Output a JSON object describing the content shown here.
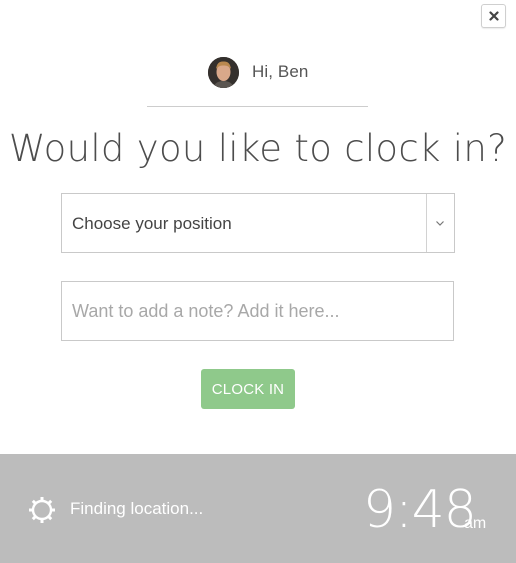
{
  "greeting": {
    "text": "Hi, Ben",
    "avatar": "user-avatar"
  },
  "headline": "Would you like to clock in?",
  "position_select": {
    "selected": "Choose your position",
    "icon": "chevron-down-icon"
  },
  "note_input": {
    "value": "",
    "placeholder": "Want to add a note? Add it here..."
  },
  "clock_in_button": {
    "label": "CLOCK IN"
  },
  "close_button": {
    "icon": "close-icon"
  },
  "footer": {
    "location_status": "Finding location...",
    "location_icon": "spinner-icon",
    "time": "9:48",
    "ampm": "am"
  },
  "colors": {
    "accent_green": "#8fc98b",
    "footer_bg": "#bcbcbc",
    "text": "#4a4a4a"
  }
}
